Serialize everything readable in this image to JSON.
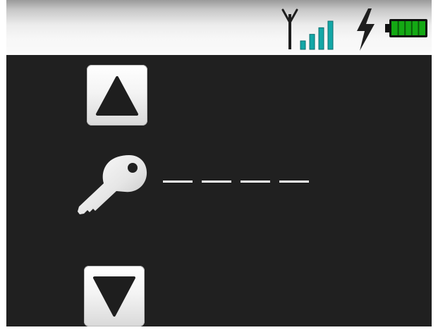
{
  "status_bar": {
    "icons": [
      "antenna-icon",
      "signal-strength-icon",
      "charging-bolt-icon",
      "battery-icon"
    ],
    "signal_bars": 4,
    "signal_color": "#13a7a7",
    "battery_level": 1.0,
    "battery_color": "#14a914",
    "charging": true
  },
  "pin_entry": {
    "digit_slots": 4,
    "entered_digits": "",
    "key_icon": "key-icon",
    "up_icon": "triangle-up-icon",
    "down_icon": "triangle-down-icon"
  },
  "colors": {
    "screen_background": "#202020",
    "pin_slot": "#ffffff"
  }
}
